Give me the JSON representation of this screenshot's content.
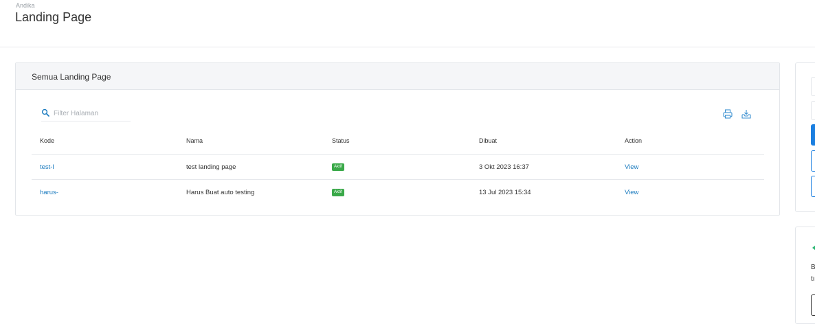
{
  "header": {
    "eyebrow": "Andika",
    "title": "Landing Page"
  },
  "card": {
    "title": "Semua Landing Page",
    "search": {
      "placeholder": "Filter Halaman",
      "icon": "search-icon"
    },
    "tools": [
      {
        "name": "print-icon"
      },
      {
        "name": "download-icon"
      }
    ],
    "columns": [
      "Kode",
      "Nama",
      "Status",
      "Dibuat",
      "Action"
    ],
    "rows": [
      {
        "kode": "test-l",
        "nama": "test landing page",
        "status": "Aktif",
        "dibuat": "3 Okt 2023 16:37",
        "action": "View"
      },
      {
        "kode": "harus-",
        "nama": "Harus Buat auto testing",
        "status": "Aktif",
        "dibuat": "13 Jul 2023 15:34",
        "action": "View"
      }
    ]
  },
  "sidebar": {
    "text1": "B",
    "text2": "tı"
  },
  "colors": {
    "link": "#1b7bbf",
    "badge": "#3aa949",
    "primary": "#1b7fe0",
    "accent_green": "#2bb673"
  }
}
